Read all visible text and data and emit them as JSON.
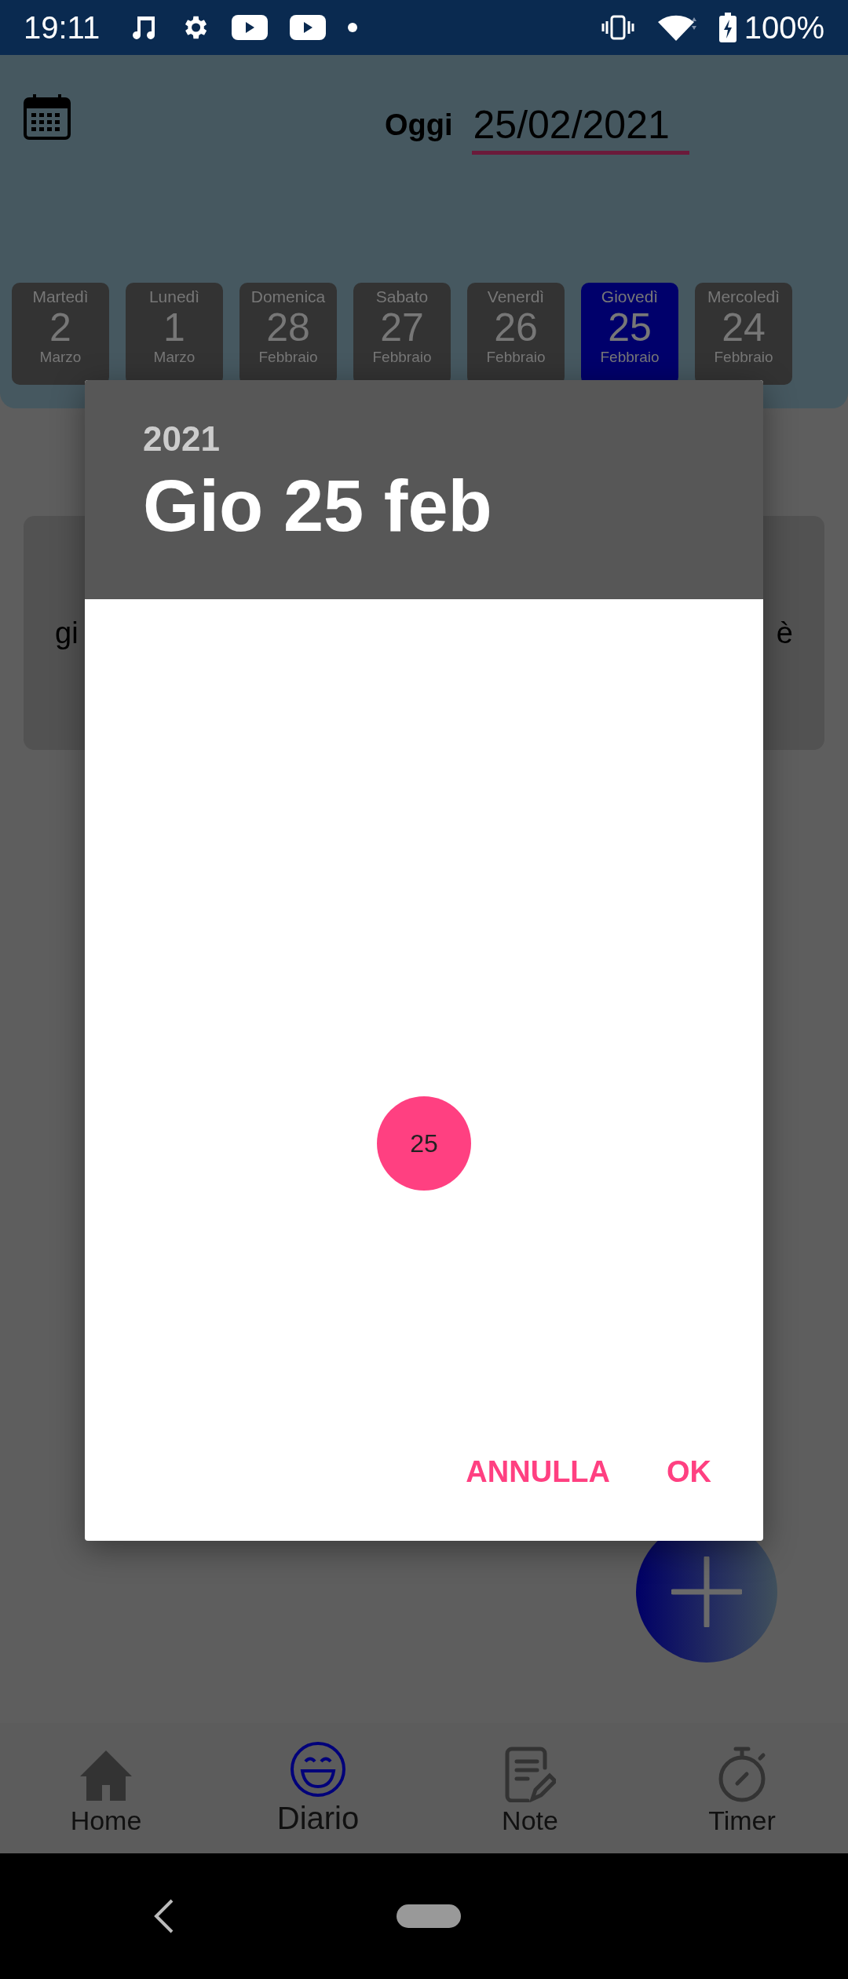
{
  "status_bar": {
    "time": "19:11",
    "battery": "100%"
  },
  "header": {
    "today_label": "Oggi",
    "date_value": "25/02/2021"
  },
  "days": [
    {
      "weekday": "Martedì",
      "day": "2",
      "month": "Marzo",
      "selected": false
    },
    {
      "weekday": "Lunedì",
      "day": "1",
      "month": "Marzo",
      "selected": false
    },
    {
      "weekday": "Domenica",
      "day": "28",
      "month": "Febbraio",
      "selected": false
    },
    {
      "weekday": "Sabato",
      "day": "27",
      "month": "Febbraio",
      "selected": false
    },
    {
      "weekday": "Venerdì",
      "day": "26",
      "month": "Febbraio",
      "selected": false
    },
    {
      "weekday": "Giovedì",
      "day": "25",
      "month": "Febbraio",
      "selected": true
    },
    {
      "weekday": "Mercoledì",
      "day": "24",
      "month": "Febbraio",
      "selected": false
    }
  ],
  "entry_card": {
    "text_left": "gi",
    "text_right": "è"
  },
  "date_dialog": {
    "year": "2021",
    "date": "Gio 25 feb",
    "selected_day": "25",
    "buttons": [
      "ANNULLA",
      "OK"
    ]
  },
  "bottom_nav": [
    {
      "kind": "home",
      "label": "Home",
      "selected": false
    },
    {
      "kind": "diary",
      "label": "Diario",
      "selected": true
    },
    {
      "kind": "notes",
      "label": "Note",
      "selected": false
    },
    {
      "kind": "timer",
      "label": "Timer",
      "selected": false
    }
  ]
}
